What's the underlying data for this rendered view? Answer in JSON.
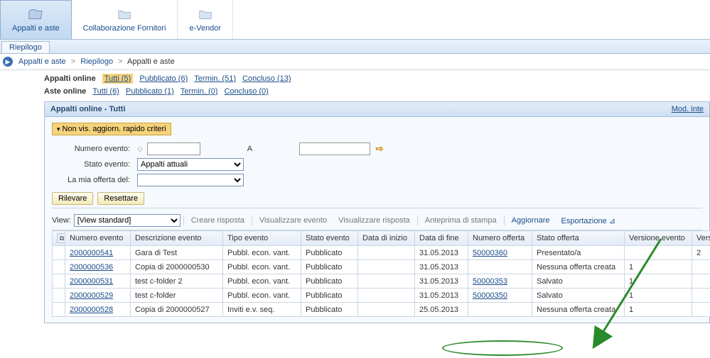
{
  "toolbar": {
    "items": [
      {
        "label": "Appalti e aste"
      },
      {
        "label": "Collaborazione Fornitori"
      },
      {
        "label": "e-Vendor"
      }
    ]
  },
  "subtab": "Riepilogo",
  "breadcrumb": {
    "items": [
      "Appalti e aste",
      "Riepilogo",
      "Appalti e aste"
    ]
  },
  "filters": {
    "appalti_label": "Appalti online",
    "aste_label": "Aste online",
    "appalti": [
      {
        "label": "Tutti (5)",
        "active": true
      },
      {
        "label": "Pubblicato (6)"
      },
      {
        "label": "Termin. (51)"
      },
      {
        "label": "Concluso (13)"
      }
    ],
    "aste": [
      {
        "label": "Tutti (6)"
      },
      {
        "label": "Pubblicato (1)"
      },
      {
        "label": "Termin. (0)"
      },
      {
        "label": "Concluso (0)"
      }
    ]
  },
  "section": {
    "title": "Appalti online - Tutti",
    "mod_link": "Mod. inte",
    "criteria_btn": "Non vis. aggiorn. rapido criteri",
    "form": {
      "numero_evento": "Numero evento:",
      "a": "A",
      "stato_evento": "Stato evento:",
      "stato_evento_val": "Appalti attuali",
      "mia_offerta": "La mia offerta del:",
      "mia_offerta_val": ""
    },
    "buttons": {
      "rilevare": "Rilevare",
      "resettare": "Resettare"
    },
    "view_label": "View:",
    "view_val": "[View standard]",
    "toolbar": {
      "creare_risposta": "Creare risposta",
      "visualizzare_evento": "Visualizzare evento",
      "visualizzare_risposta": "Visualizzare risposta",
      "anteprima": "Anteprima di stampa",
      "aggiornare": "Aggiornare",
      "esportazione": "Esportazione"
    },
    "columns": [
      "Numero evento",
      "Descrizione evento",
      "Tipo evento",
      "Stato evento",
      "Data di inizio",
      "Data di fine",
      "Numero offerta",
      "Stato offerta",
      "Versione evento",
      "Versione offerta"
    ],
    "rows": [
      {
        "numero_evento": "2000000541",
        "descrizione": "Gara di Test",
        "tipo": "Pubbl. econ. vant.",
        "stato": "Pubblicato",
        "inizio": "",
        "fine": "31.05.2013",
        "numero_offerta": "50000360",
        "stato_offerta": "Presentato/a",
        "versione_evento": "",
        "versione_offerta": "2"
      },
      {
        "numero_evento": "2000000536",
        "descrizione": "Copia di 2000000530",
        "tipo": "Pubbl. econ. vant.",
        "stato": "Pubblicato",
        "inizio": "",
        "fine": "31.05.2013",
        "numero_offerta": "",
        "stato_offerta": "Nessuna offerta creata",
        "versione_evento": "1",
        "versione_offerta": ""
      },
      {
        "numero_evento": "2000000531",
        "descrizione": "test c-folder 2",
        "tipo": "Pubbl. econ. vant.",
        "stato": "Pubblicato",
        "inizio": "",
        "fine": "31.05.2013",
        "numero_offerta": "50000353",
        "stato_offerta": "Salvato",
        "versione_evento": "1",
        "versione_offerta": ""
      },
      {
        "numero_evento": "2000000529",
        "descrizione": "test c-folder",
        "tipo": "Pubbl. econ. vant.",
        "stato": "Pubblicato",
        "inizio": "",
        "fine": "31.05.2013",
        "numero_offerta": "50000350",
        "stato_offerta": "Salvato",
        "versione_evento": "1",
        "versione_offerta": ""
      },
      {
        "numero_evento": "2000000528",
        "descrizione": "Copia di 2000000527",
        "tipo": "Inviti e.v. seq.",
        "stato": "Pubblicato",
        "inizio": "",
        "fine": "25.05.2013",
        "numero_offerta": "",
        "stato_offerta": "Nessuna offerta creata",
        "versione_evento": "1",
        "versione_offerta": ""
      }
    ]
  }
}
